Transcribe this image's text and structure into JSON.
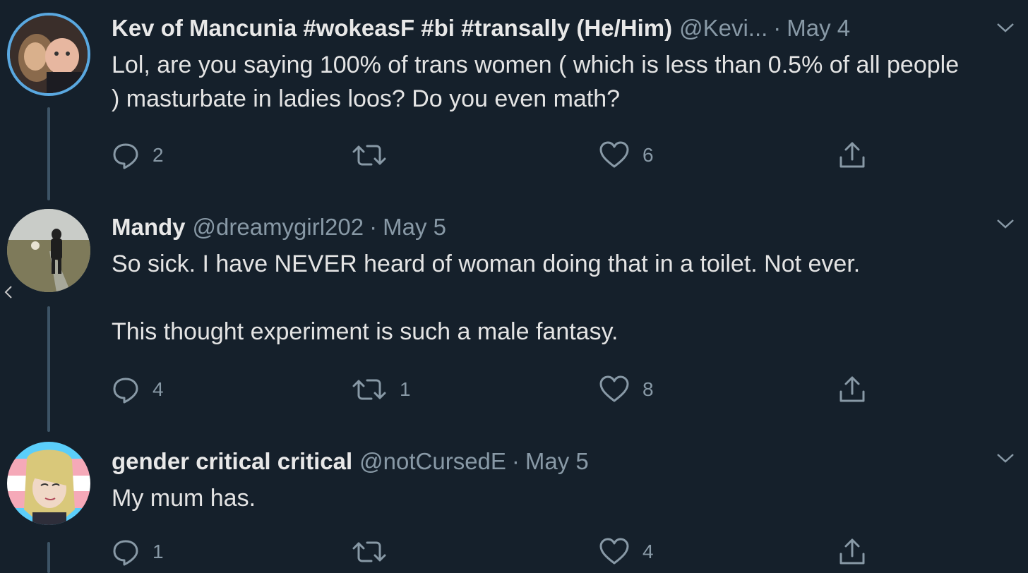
{
  "tweets": [
    {
      "name": "Kev of Mancunia #wokeasF #bi #transally (He/Him)",
      "handle": "@Kevi...",
      "date": "May 4",
      "body": [
        "Lol, are you saying 100% of trans women ( which is less than 0.5% of all people ) masturbate in ladies loos? Do you even math?"
      ],
      "replies": "2",
      "retweets": "",
      "likes": "6"
    },
    {
      "name": "Mandy",
      "handle": "@dreamygirl202",
      "date": "May 5",
      "body": [
        "So sick. I have NEVER heard of woman doing that in a  toilet. Not ever.",
        "This thought experiment is such a male fantasy."
      ],
      "replies": "4",
      "retweets": "1",
      "likes": "8"
    },
    {
      "name": "gender critical critical",
      "handle": "@notCursedE",
      "date": "May 5",
      "body": [
        "My mum has."
      ],
      "replies": "1",
      "retweets": "",
      "likes": "4"
    }
  ],
  "separator": "·",
  "colors": {
    "background": "#15202b",
    "muted": "#8899a6",
    "text": "#e4e4e4",
    "thread_line": "#3d5466"
  },
  "icons": [
    "reply-icon",
    "retweet-icon",
    "like-icon",
    "share-icon",
    "chevron-down-icon",
    "chevron-left-icon"
  ]
}
